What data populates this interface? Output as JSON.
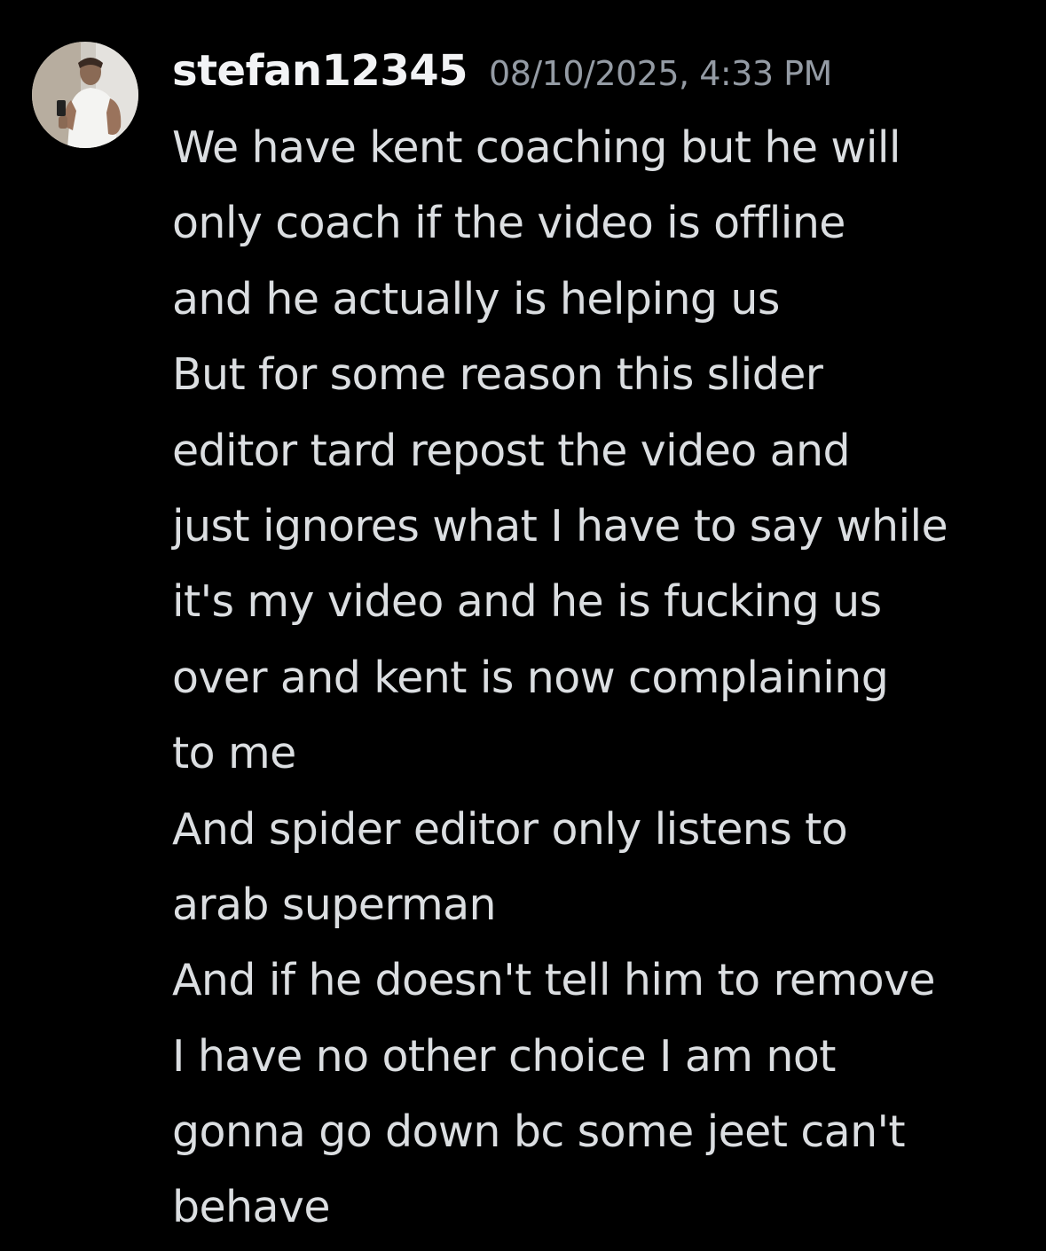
{
  "message": {
    "author": {
      "username": "stefan12345",
      "avatar_icon": "user-avatar-photo"
    },
    "timestamp": "08/10/2025, 4:33 PM",
    "lines": [
      "We have kent coaching but he will",
      "only coach if the video is offline",
      "and he actually is helping us",
      "But for some reason this slider",
      "editor tard repost the video and",
      "just ignores what I have to say while",
      "it's my video and he is fucking us",
      "over and kent is now complaining",
      "to me",
      "And spider editor only listens to",
      "arab superman",
      "And if he doesn't tell him to remove",
      "I have no other choice I am not",
      "gonna go down bc some jeet can't",
      "behave"
    ]
  },
  "colors": {
    "background": "#000000",
    "username": "#f2f3f5",
    "timestamp": "#949ba4",
    "message_text": "#dbdee1"
  }
}
